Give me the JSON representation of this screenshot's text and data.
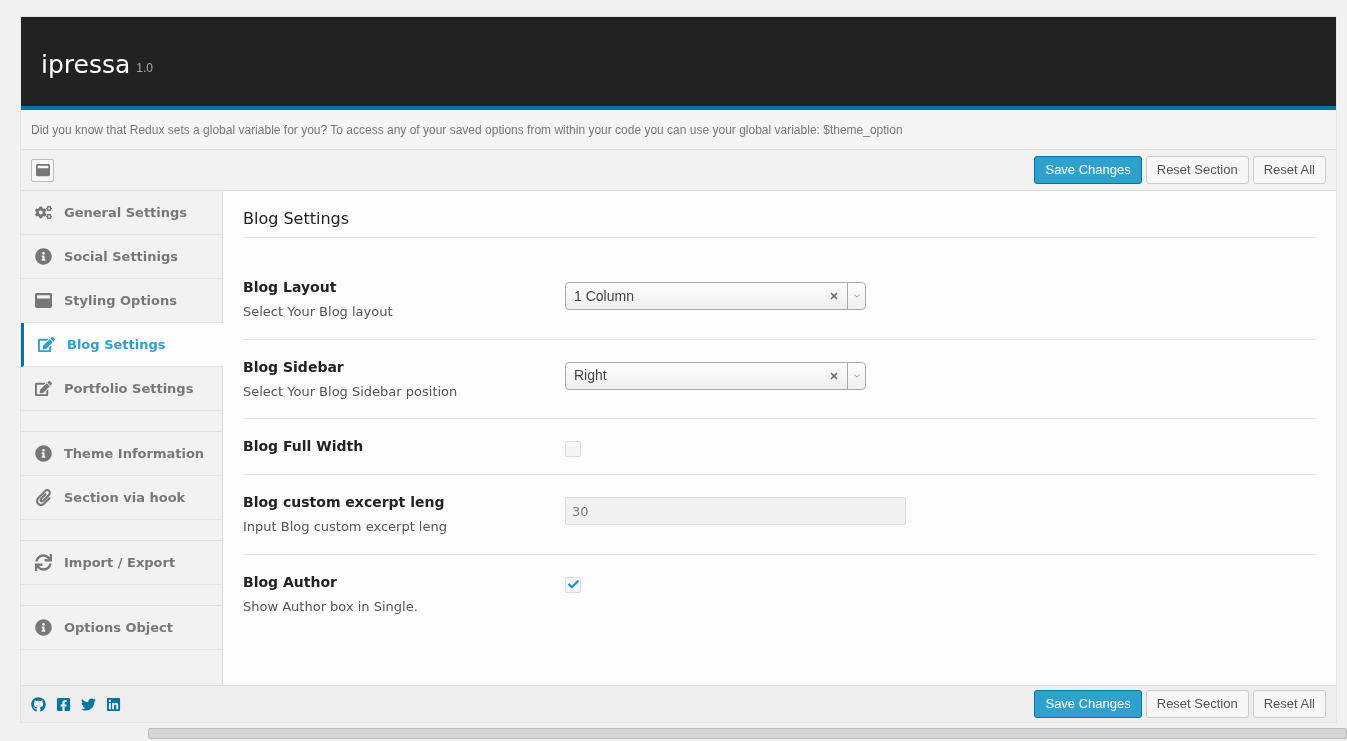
{
  "header": {
    "title": "ipressa",
    "version": "1.0"
  },
  "notice": "Did you know that Redux sets a global variable for you? To access any of your saved options from within your code you can use your global variable: $theme_option",
  "buttons": {
    "save": "Save Changes",
    "reset_section": "Reset Section",
    "reset_all": "Reset All"
  },
  "sidebar": {
    "groups": [
      [
        {
          "label": "General Settings",
          "selected": false
        },
        {
          "label": "Social Settinigs",
          "selected": false
        },
        {
          "label": "Styling Options",
          "selected": false
        },
        {
          "label": "Blog Settings",
          "selected": true
        },
        {
          "label": "Portfolio Settings",
          "selected": false
        }
      ],
      [
        {
          "label": "Theme Information",
          "selected": false
        },
        {
          "label": "Section via hook",
          "selected": false
        }
      ],
      [
        {
          "label": "Import / Export",
          "selected": false
        }
      ],
      [
        {
          "label": "Options Object",
          "selected": false
        }
      ]
    ]
  },
  "section": {
    "title": "Blog Settings",
    "fields": [
      {
        "kind": "select",
        "label": "Blog Layout",
        "description": "Select Your Blog layout",
        "value": "1 Column"
      },
      {
        "kind": "select",
        "label": "Blog Sidebar",
        "description": "Select Your Blog Sidebar position",
        "value": "Right"
      },
      {
        "kind": "checkbox",
        "label": "Blog Full Width",
        "checked": false
      },
      {
        "kind": "text",
        "label": "Blog custom excerpt leng",
        "description": "Input Blog custom excerpt leng",
        "value": "30"
      },
      {
        "kind": "checkbox",
        "label": "Blog Author",
        "description": "Show Author box in Single.",
        "checked": true
      }
    ]
  },
  "footer_buttons": {
    "save": "Save Changes",
    "reset_section": "Reset Section",
    "reset_all": "Reset All"
  }
}
